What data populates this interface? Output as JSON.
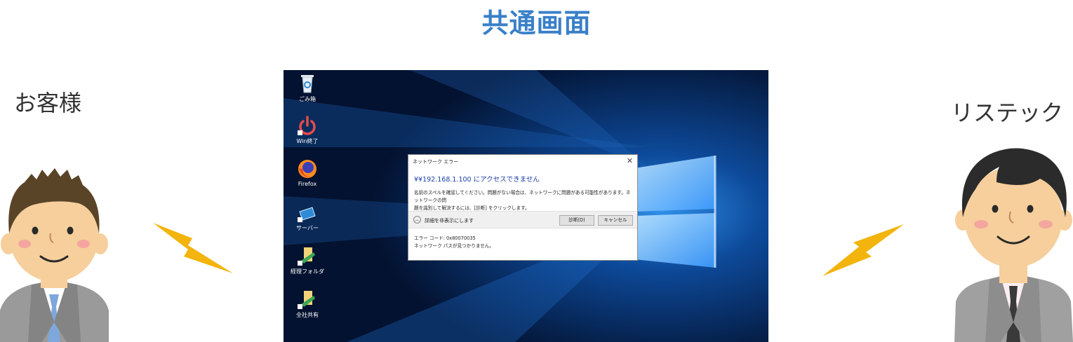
{
  "header": {
    "title": "共通画面"
  },
  "customer": {
    "label": "お客様"
  },
  "ristec": {
    "label": "リステック"
  },
  "desktop": {
    "icons": [
      {
        "label": "ごみ箱",
        "icon": "recycle-bin-icon"
      },
      {
        "label": "Win終了",
        "icon": "power-icon"
      },
      {
        "label": "Firefox",
        "icon": "firefox-icon"
      },
      {
        "label": "サーバー",
        "icon": "server-shortcut-icon"
      },
      {
        "label": "経理フォルダ",
        "icon": "folder-shortcut-icon"
      },
      {
        "label": "全社共有",
        "icon": "folder-shortcut-icon"
      }
    ]
  },
  "dialog": {
    "title": "ネットワーク エラー",
    "heading": "¥¥192.168.1.100 にアクセスできません",
    "body_line1": "名前のスペルを確認してください。問題がない場合は、ネットワークに問題がある可能性があります。ネットワークの問",
    "body_line2": "題を識別して解決するには、[診断] をクリックします。",
    "details_toggle": "詳細を非表示にします",
    "diagnose_button": "診断(D)",
    "cancel_button": "キャンセル",
    "error_code": "エラー コード: 0x80070035",
    "error_message": "ネットワーク パスが見つかりません。"
  },
  "colors": {
    "title": "#3a80c8",
    "bolt": "#f2b40d",
    "desktop_bg": "#03112b",
    "dialog_heading": "#1a3fa8"
  }
}
